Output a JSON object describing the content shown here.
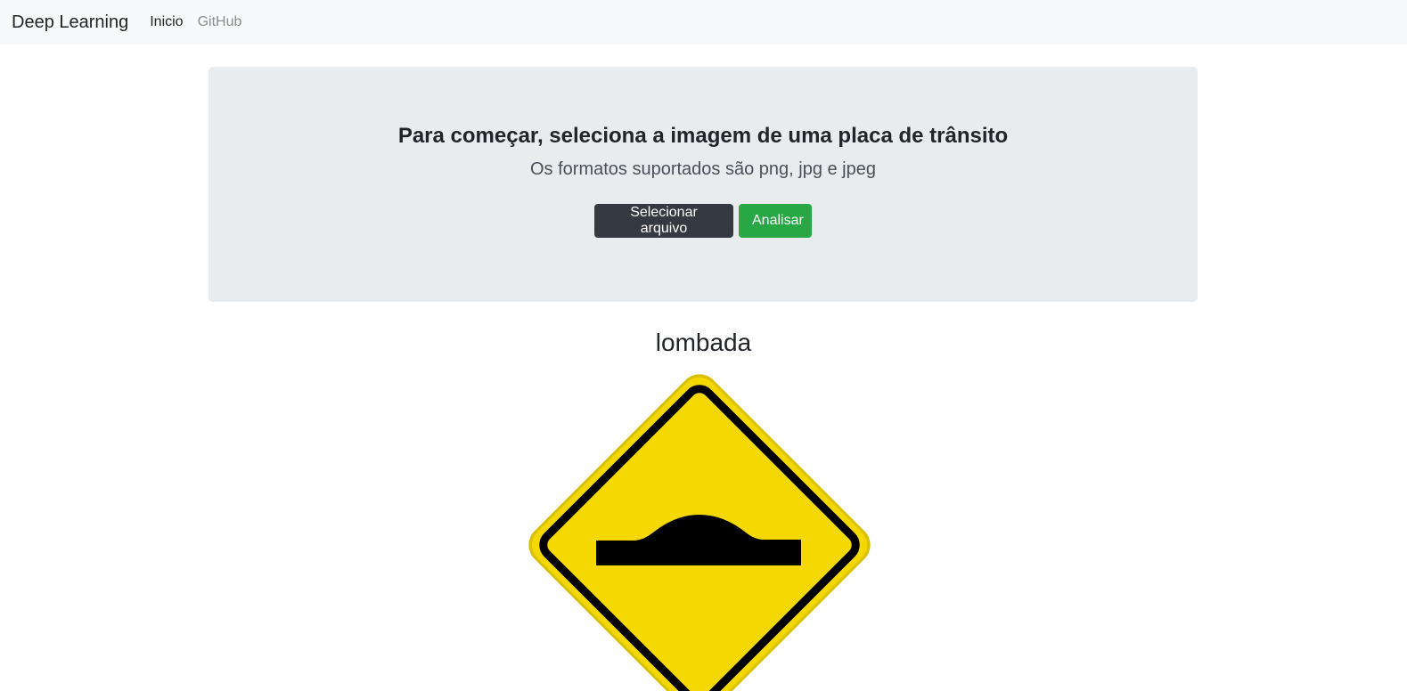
{
  "navbar": {
    "brand": "Deep Learning",
    "links": [
      "Inicio",
      "GitHub"
    ]
  },
  "hero": {
    "title": "Para começar, seleciona a imagem de uma placa de trânsito",
    "subtitle": "Os formatos suportados são png, jpg e jpeg",
    "select_button": "Selecionar arquivo",
    "analyze_button": "Analisar"
  },
  "result": {
    "label": "lombada",
    "sign_icon": "speed-bump-warning-sign",
    "sign_color": "#f5d800"
  },
  "colors": {
    "navbar_bg": "#f8f9fa",
    "hero_bg": "#e9ecef",
    "btn_dark": "#343a40",
    "btn_success": "#28a745"
  }
}
